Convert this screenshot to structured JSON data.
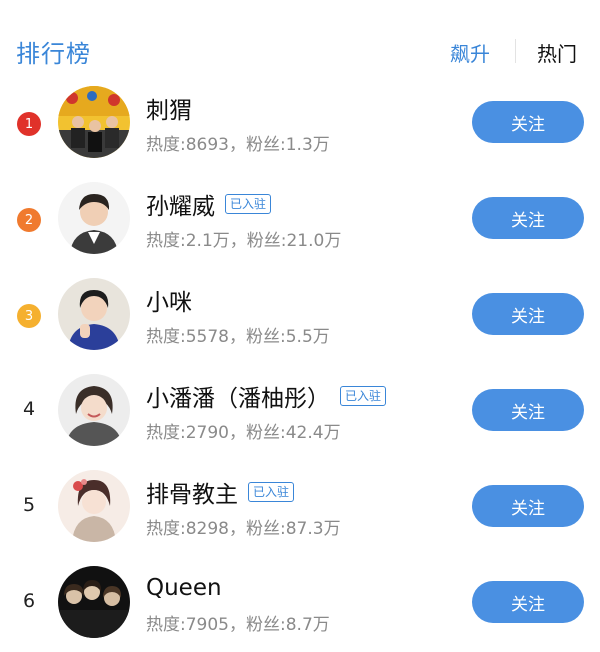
{
  "header": {
    "title": "排行榜",
    "tabs": [
      {
        "label": "飙升",
        "color": "#3a86d8",
        "active": true
      },
      {
        "label": "热门",
        "color": "#111111",
        "active": false
      }
    ]
  },
  "colors": {
    "accent": "#3a86d8",
    "button": "#4a90e2",
    "rank1": "#e0322a",
    "rank2": "#f07a2e",
    "rank3": "#f5b02f"
  },
  "rankings": [
    {
      "rank": "1",
      "name": "刺猬",
      "verified": "",
      "stats": "热度:8693，粉丝:1.3万",
      "follow_label": "关注"
    },
    {
      "rank": "2",
      "name": "孙耀威",
      "verified": "已入驻",
      "stats": "热度:2.1万，粉丝:21.0万",
      "follow_label": "关注"
    },
    {
      "rank": "3",
      "name": "小咪",
      "verified": "",
      "stats": "热度:5578，粉丝:5.5万",
      "follow_label": "关注"
    },
    {
      "rank": "4",
      "name": "小潘潘（潘柚彤）",
      "verified": "已入驻",
      "stats": "热度:2790，粉丝:42.4万",
      "follow_label": "关注"
    },
    {
      "rank": "5",
      "name": "排骨教主",
      "verified": "已入驻",
      "stats": "热度:8298，粉丝:87.3万",
      "follow_label": "关注"
    },
    {
      "rank": "6",
      "name": "Queen",
      "verified": "",
      "stats": "热度:7905，粉丝:8.7万",
      "follow_label": "关注"
    }
  ]
}
